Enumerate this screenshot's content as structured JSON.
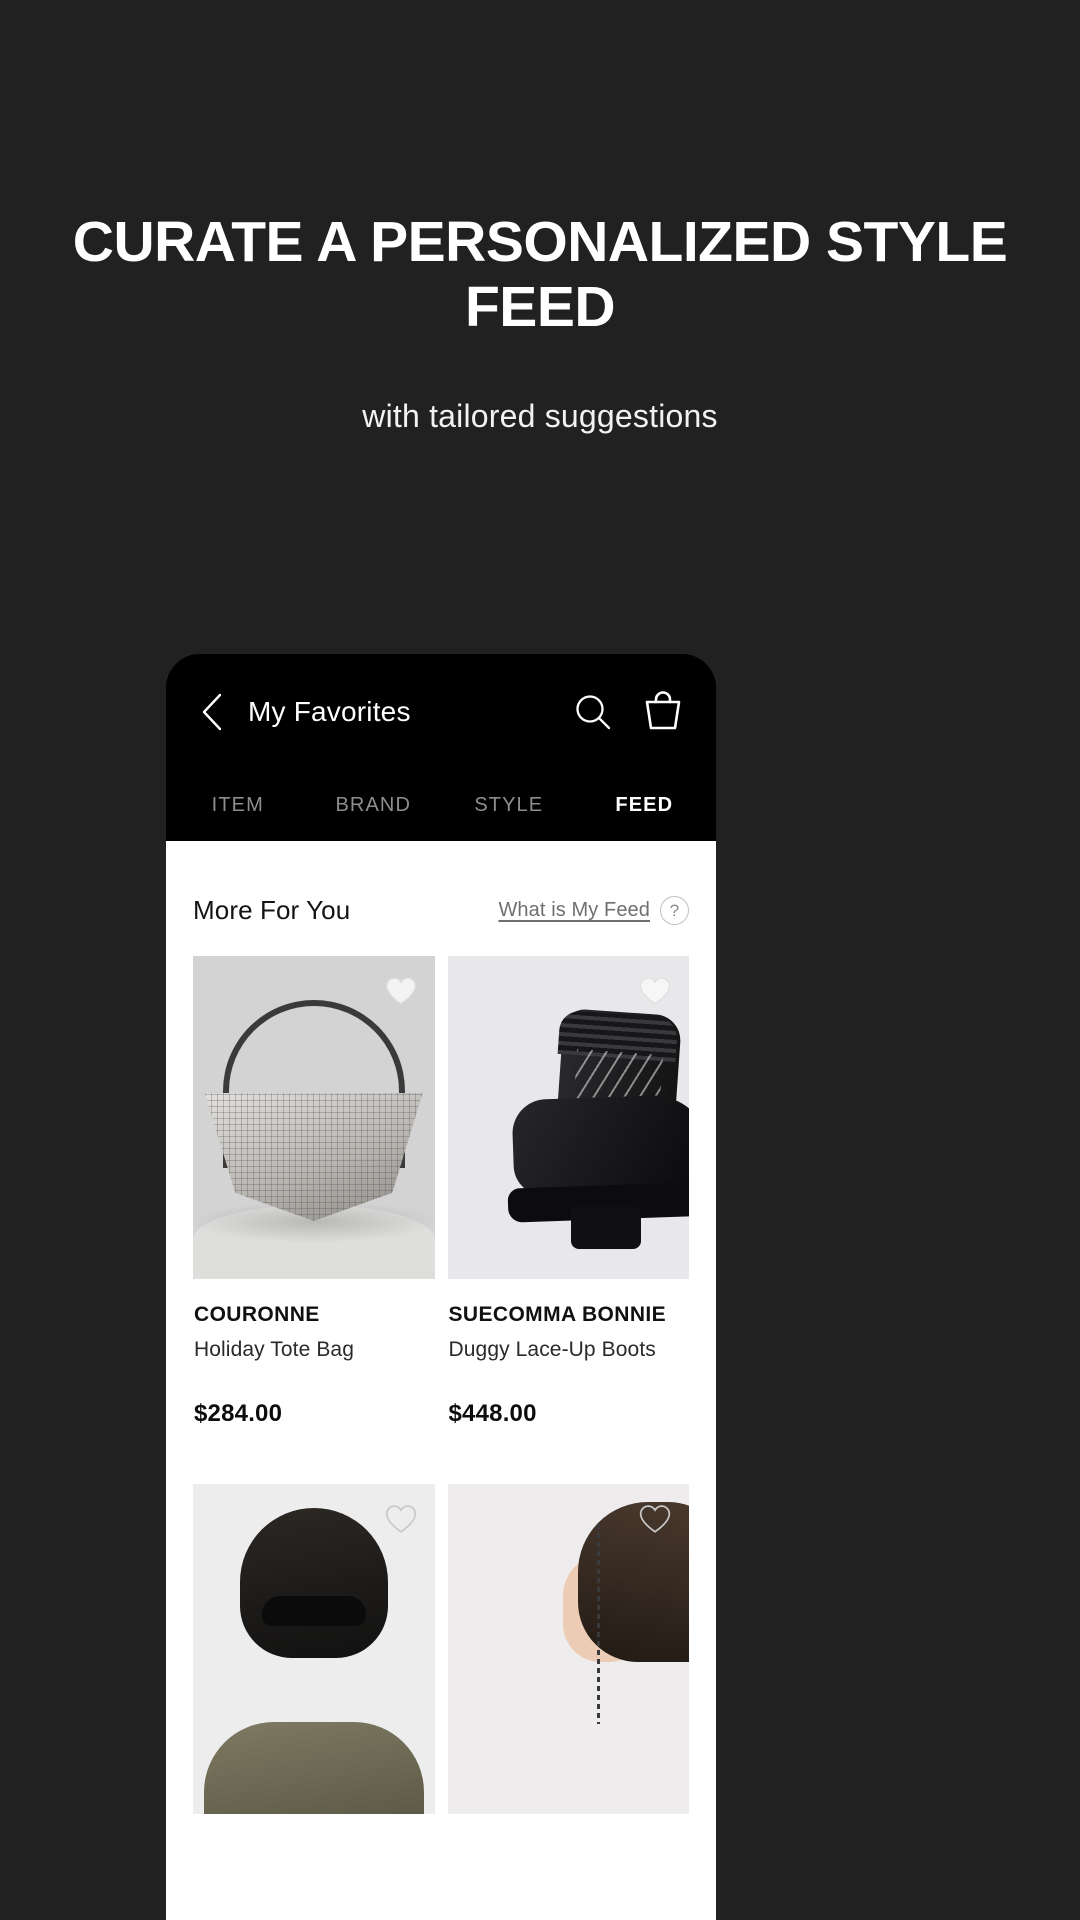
{
  "promo": {
    "headline": "CURATE A PERSONALIZED STYLE FEED",
    "subheadline": "with tailored suggestions",
    "background_color": "#212121",
    "text_color": "#ffffff"
  },
  "app": {
    "header": {
      "back_icon": "chevron-left-icon",
      "title": "My Favorites",
      "search_icon": "search-icon",
      "bag_icon": "shopping-bag-icon"
    },
    "tabs": [
      {
        "label": "ITEM",
        "active": false
      },
      {
        "label": "BRAND",
        "active": false
      },
      {
        "label": "STYLE",
        "active": false
      },
      {
        "label": "FEED",
        "active": true
      }
    ],
    "feed": {
      "section_title": "More For You",
      "help_link": "What is My Feed",
      "help_badge": "?",
      "favorite_icon": "heart-icon",
      "products": [
        {
          "brand": "COURONNE",
          "name": "Holiday Tote Bag",
          "price": "$284.00",
          "image": "rhinestone-shoulder-bag",
          "favorited": true
        },
        {
          "brand": "SUECOMMA BONNIE",
          "name": "Duggy Lace-Up Boots",
          "price": "$448.00",
          "image": "black-lace-up-boot",
          "favorited": true
        },
        {
          "brand": "",
          "name": "",
          "price": "",
          "image": "model-with-sunglasses",
          "favorited": false
        },
        {
          "brand": "",
          "name": "",
          "price": "",
          "image": "model-with-hair-chain",
          "favorited": false
        }
      ]
    }
  }
}
